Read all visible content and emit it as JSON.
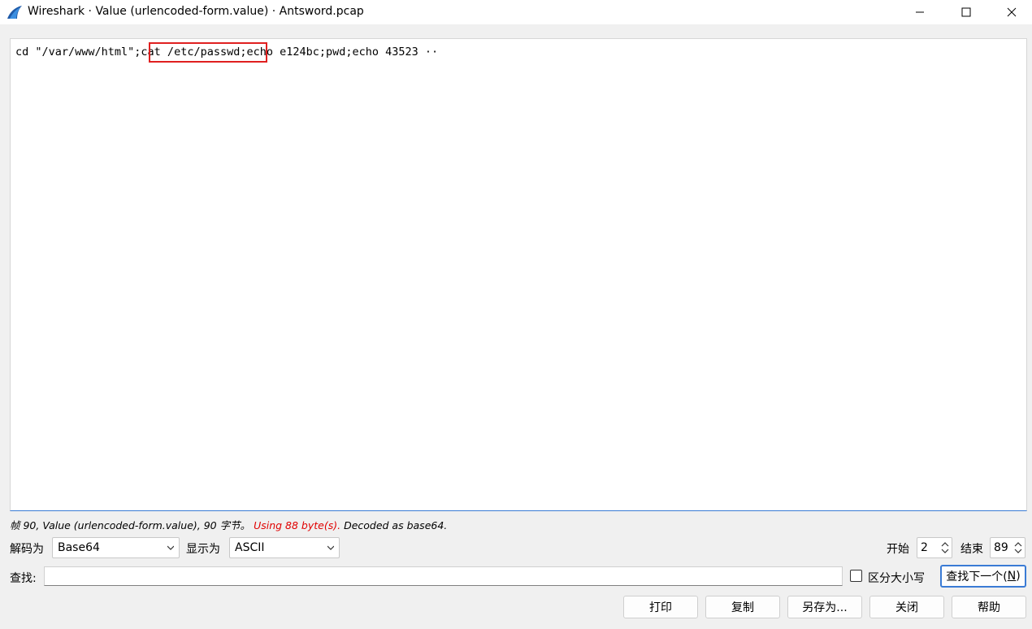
{
  "window": {
    "title": "Wireshark · Value (urlencoded-form.value) · Antsword.pcap"
  },
  "viewer": {
    "content": "cd \"/var/www/html\";cat /etc/passwd;echo e124bc;pwd;echo 43523 ··"
  },
  "status": {
    "prefix": "帧 90, Value (urlencoded-form.value), 90 字节。",
    "warning": " Using 88 byte(s).",
    "suffix": " Decoded as base64."
  },
  "decode": {
    "label": "解码为",
    "value": "Base64"
  },
  "show_as": {
    "label": "显示为",
    "value": "ASCII"
  },
  "range": {
    "start_label": "开始",
    "start_value": "2",
    "end_label": "结束",
    "end_value": "89"
  },
  "find": {
    "label": "查找:",
    "value": "",
    "case_label": "区分大小写",
    "next_label": "查找下一个(",
    "next_key": "N",
    "next_close": ")"
  },
  "buttons": {
    "print": "打印",
    "copy": "复制",
    "save_as": "另存为...",
    "close": "关闭",
    "help": "帮助"
  },
  "colors": {
    "highlight_border": "#e02020",
    "warning_text": "#e00000",
    "focus_border": "#3a7bd5"
  }
}
